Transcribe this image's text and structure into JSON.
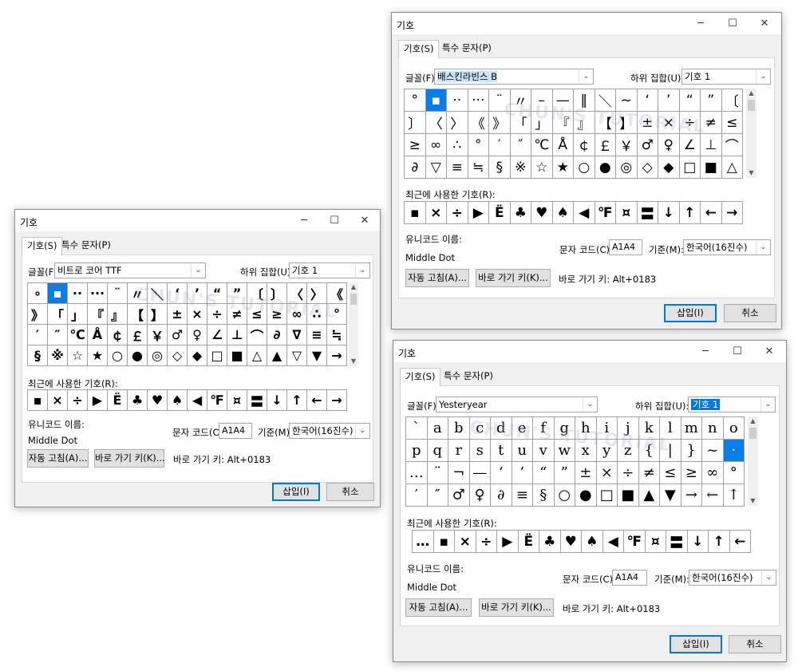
{
  "common": {
    "title": "기호",
    "tab_symbols": "기호(S)",
    "tab_special": "특수 문자(P)",
    "font_label": "글꼴(F):",
    "subset_label": "하위 집합(U):",
    "recent_label": "최근에 사용한 기호(R):",
    "unicode_name_label": "유니코드 이름:",
    "unicode_name": "Middle Dot",
    "char_code_label": "문자 코드(C):",
    "char_code": "A1A4",
    "from_label": "기준(M):",
    "from_value": "한국어(16진수)",
    "autocorrect_button": "자동 고침(A)...",
    "shortcut_key_button": "바로 가기 키(K)...",
    "shortcut_text": "바로 가기 키: Alt+0183",
    "insert_button": "삽입(I)",
    "cancel_button": "취소",
    "minimize_icon": "─",
    "maximize_icon": "☐",
    "close_icon": "✕",
    "scroll_up_icon": "▲",
    "scroll_down_icon": "▼",
    "dropdown_icon": "⌄"
  },
  "left": {
    "font": "비트로 코어 TTF",
    "subset": "기호 1",
    "grid": [
      "∘",
      "▪",
      "··",
      "···",
      "¨",
      "〃",
      "＼",
      "‘",
      "’",
      "“",
      "”",
      "〔",
      "〕",
      "〈",
      "〉",
      "《",
      "》",
      "「",
      "」",
      "『",
      "』",
      "【",
      "】",
      "±",
      "×",
      "÷",
      "≠",
      "≤",
      "≥",
      "∞",
      "∴",
      "°",
      "′",
      "″",
      "℃",
      "Å",
      "￠",
      "￡",
      "￥",
      "♂",
      "♀",
      "∠",
      "⊥",
      "⌒",
      "∂",
      "∇",
      "≡",
      "≒",
      "§",
      "※",
      "☆",
      "★",
      "○",
      "●",
      "◎",
      "◇",
      "◆",
      "□",
      "■",
      "△",
      "▲",
      "▽",
      "▼",
      "→"
    ],
    "selected_index": 1,
    "recent": [
      "▪",
      "×",
      "÷",
      "▶",
      "Ë",
      "♣",
      "♥",
      "♠",
      "◀",
      "℉",
      "¤",
      "〓",
      "↓",
      "↑",
      "←",
      "→"
    ]
  },
  "top": {
    "font": "배스킨라빈스 B",
    "subset": "기호 1",
    "grid": [
      "°",
      "▪",
      "··",
      "···",
      "¨",
      "〃",
      "–",
      "—",
      "‖",
      "＼",
      "~",
      "‘",
      "’",
      "“",
      "”",
      "〔",
      "〕",
      "〈",
      "〉",
      "《",
      "》",
      "「",
      "」",
      "『",
      "』",
      "【",
      "】",
      "±",
      "×",
      "÷",
      "≠",
      "≤",
      "≥",
      "∞",
      "∴",
      "°",
      "′",
      "″",
      "℃",
      "Å",
      "￠",
      "￡",
      "￥",
      "♂",
      "♀",
      "∠",
      "⊥",
      "⌒",
      "∂",
      "▽",
      "≡",
      "≒",
      "§",
      "※",
      "☆",
      "★",
      "○",
      "●",
      "◎",
      "◇",
      "◆",
      "□",
      "■",
      "△"
    ],
    "selected_index": 1,
    "recent": [
      "▪",
      "×",
      "÷",
      "▶",
      "Ë",
      "♣",
      "♥",
      "♠",
      "◀",
      "℉",
      "¤",
      "〓",
      "↓",
      "↑",
      "←",
      "→"
    ]
  },
  "bottom": {
    "font": "Yesteryear",
    "subset": "기호 1",
    "grid": [
      "`",
      "a",
      "b",
      "c",
      "d",
      "e",
      "f",
      "g",
      "h",
      "i",
      "j",
      "k",
      "l",
      "m",
      "n",
      "o",
      "p",
      "q",
      "r",
      "s",
      "t",
      "u",
      "v",
      "w",
      "x",
      "y",
      "z",
      "{",
      "|",
      "}",
      "~",
      "·",
      "…",
      "¨",
      "¬",
      "—",
      "‘",
      "’",
      "“",
      "”",
      "±",
      "×",
      "÷",
      "≠",
      "≤",
      "≥",
      "∞",
      "°",
      "′",
      "″",
      "♂",
      "♀",
      "∂",
      "≡",
      "§",
      "○",
      "●",
      "□",
      "■",
      "▲",
      "▼",
      "→",
      "←",
      "↑"
    ],
    "selected_index": 31,
    "recent": [
      "…",
      "▪",
      "×",
      "÷",
      "▶",
      "Ë",
      "♣",
      "♥",
      "♠",
      "◀",
      "℉",
      "¤",
      "〓",
      "↓",
      "↑",
      "←"
    ]
  },
  "watermark": "CHUN'S TUTORIAL"
}
